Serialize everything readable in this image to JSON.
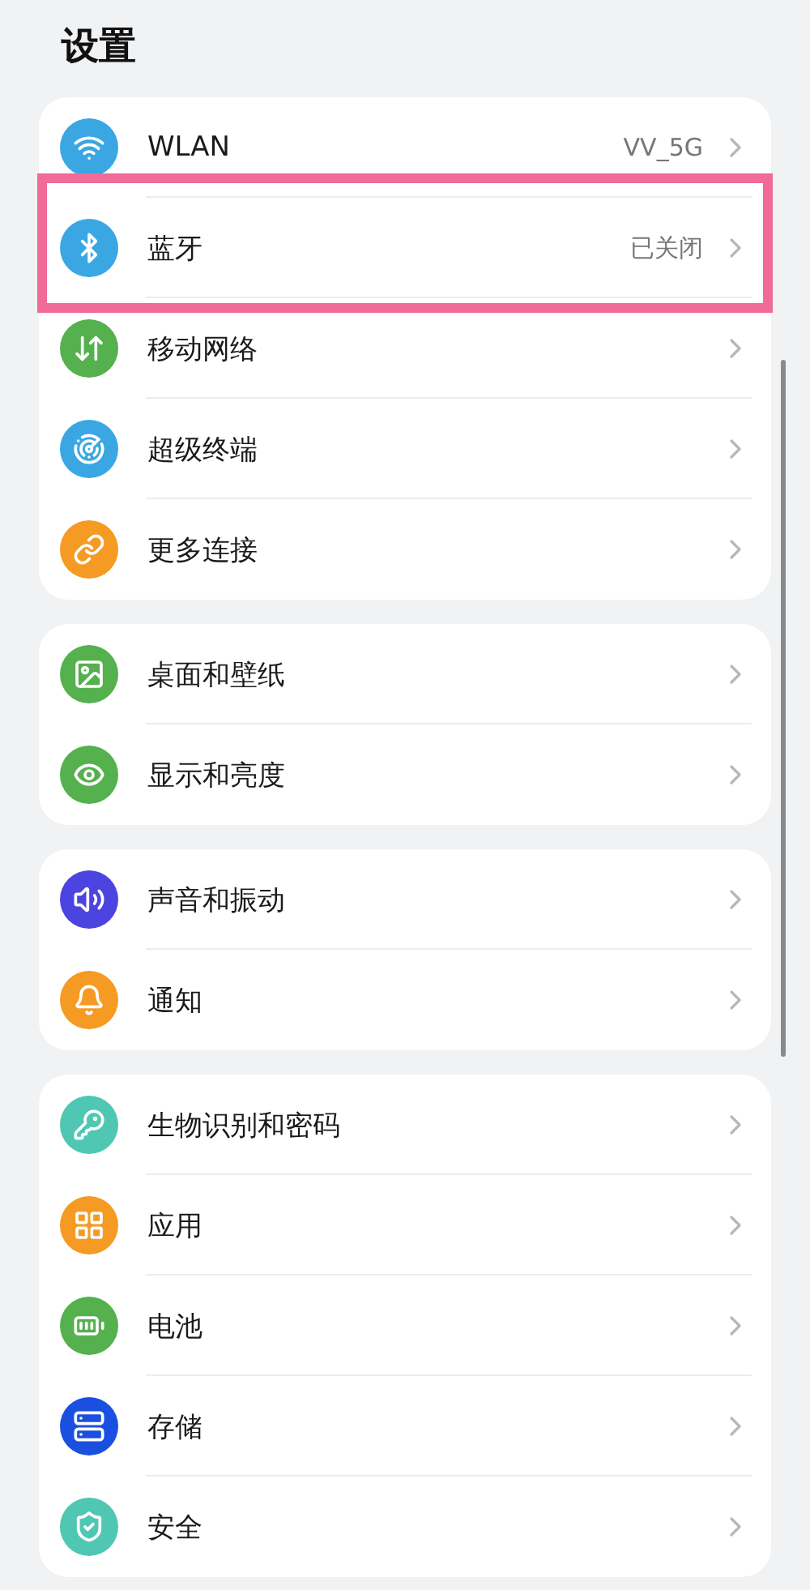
{
  "title": "设置",
  "groups": [
    {
      "items": [
        {
          "label": "WLAN",
          "value": "VV_5G",
          "color": "#3aa7e3",
          "highlighted": false
        },
        {
          "label": "蓝牙",
          "value": "已关闭",
          "color": "#3aa7e3",
          "highlighted": true
        },
        {
          "label": "移动网络",
          "color": "#55b04e",
          "highlighted": false
        },
        {
          "label": "超级终端",
          "color": "#3aa7e3",
          "highlighted": false
        },
        {
          "label": "更多连接",
          "color": "#f59a23",
          "highlighted": false
        }
      ]
    },
    {
      "items": [
        {
          "label": "桌面和壁纸",
          "color": "#55b04e",
          "highlighted": false
        },
        {
          "label": "显示和亮度",
          "color": "#55b04e",
          "highlighted": false
        }
      ]
    },
    {
      "items": [
        {
          "label": "声音和振动",
          "color": "#4b44e0",
          "highlighted": false
        },
        {
          "label": "通知",
          "color": "#f59a23",
          "highlighted": false
        }
      ]
    },
    {
      "items": [
        {
          "label": "生物识别和密码",
          "color": "#4fc7b3",
          "highlighted": false
        },
        {
          "label": "应用",
          "color": "#f59a23",
          "highlighted": false
        },
        {
          "label": "电池",
          "color": "#55b04e",
          "highlighted": false
        },
        {
          "label": "存储",
          "color": "#1a4fe0",
          "highlighted": false
        },
        {
          "label": "安全",
          "color": "#4fc7b3",
          "highlighted": false
        }
      ]
    }
  ]
}
